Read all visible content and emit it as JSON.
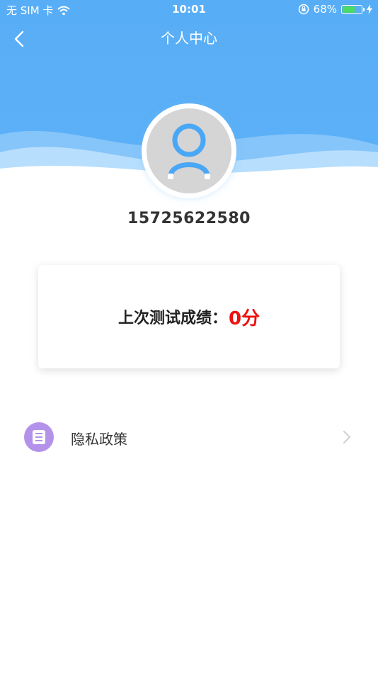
{
  "status_bar": {
    "carrier": "无 SIM 卡",
    "time": "10:01",
    "battery_percent": "68%",
    "battery_level": 0.68
  },
  "nav": {
    "title": "个人中心"
  },
  "profile": {
    "phone": "15725622580"
  },
  "score": {
    "label": "上次测试成绩：",
    "value": "0分"
  },
  "menu": [
    {
      "label": "隐私政策",
      "icon": "document-icon"
    }
  ],
  "colors": {
    "header_blue": "#5cb0f7",
    "score_red": "#ee1111",
    "menu_icon_purple": "#b592ea"
  }
}
